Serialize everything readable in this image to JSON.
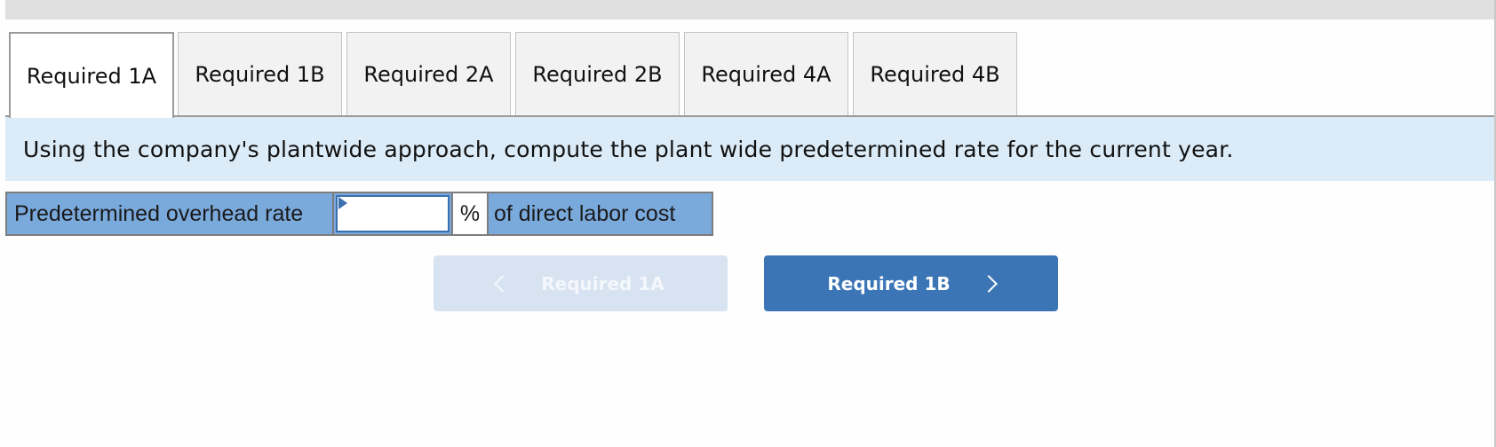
{
  "tabs": [
    {
      "label": "Required 1A",
      "active": true
    },
    {
      "label": "Required 1B",
      "active": false
    },
    {
      "label": "Required 2A",
      "active": false
    },
    {
      "label": "Required 2B",
      "active": false
    },
    {
      "label": "Required 4A",
      "active": false
    },
    {
      "label": "Required 4B",
      "active": false
    }
  ],
  "instructions": "Using the company's plantwide approach, compute the plant wide predetermined rate for the current year.",
  "answer_row": {
    "label": "Predetermined overhead rate",
    "input_value": "",
    "unit": "%",
    "suffix": "of direct labor cost"
  },
  "navigation": {
    "prev_label": "Required 1A",
    "next_label": "Required 1B",
    "prev_icon": "chevron-left-icon",
    "next_icon": "chevron-right-icon"
  },
  "colors": {
    "instruction_bg": "#dbebf7",
    "row_bg": "#7aa9dc",
    "next_button": "#3c75b6",
    "prev_button_disabled": "#d7e3f1"
  }
}
